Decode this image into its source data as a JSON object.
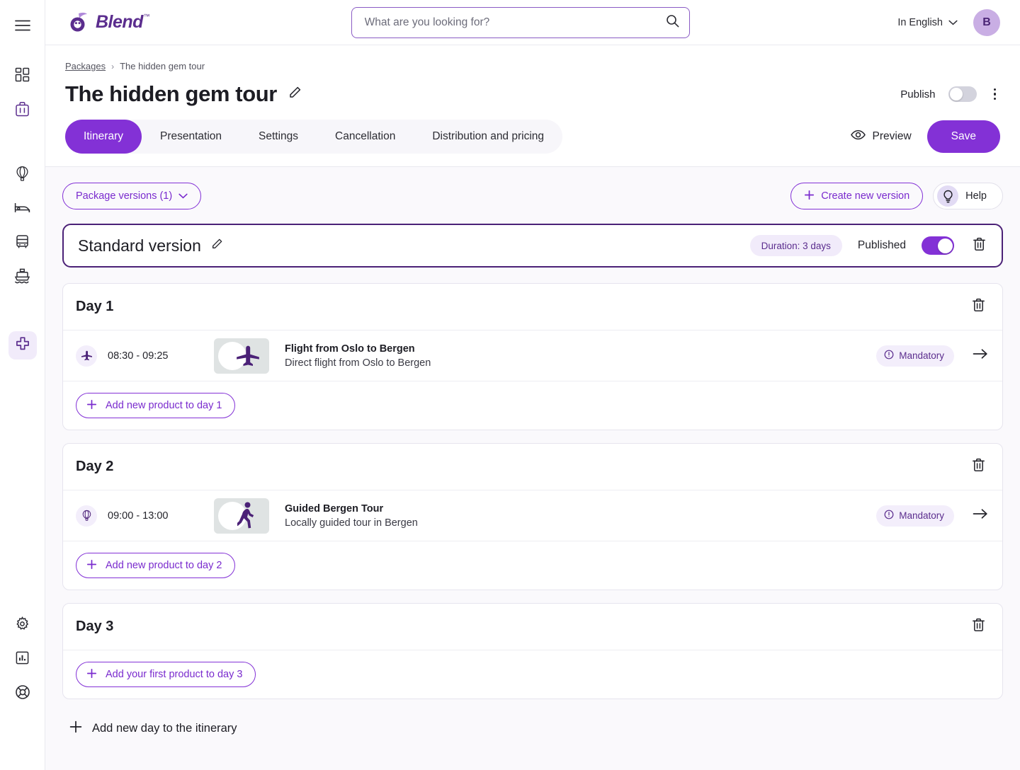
{
  "sidebar": {
    "menu_icon": "hamburger-icon",
    "items": [
      {
        "icon": "dashboard-grid-icon",
        "name": "dashboard",
        "active": false
      },
      {
        "icon": "suitcase-icon",
        "name": "trips",
        "active": false
      },
      {
        "icon": "balloon-icon",
        "name": "activities",
        "active": false
      },
      {
        "icon": "bed-icon",
        "name": "accommodation",
        "active": false
      },
      {
        "icon": "bus-icon",
        "name": "transport",
        "active": false
      },
      {
        "icon": "ship-icon",
        "name": "cruises",
        "active": false
      },
      {
        "icon": "packages-icon",
        "name": "packages",
        "active": true
      }
    ],
    "bottom_items": [
      {
        "icon": "gear-icon",
        "name": "settings"
      },
      {
        "icon": "chart-icon",
        "name": "reports"
      },
      {
        "icon": "lifebuoy-icon",
        "name": "support"
      }
    ]
  },
  "topbar": {
    "brand": "Blend",
    "brand_tm": "™",
    "search_placeholder": "What are you looking for?",
    "search_value": "",
    "language": "In English",
    "avatar_initial": "B"
  },
  "breadcrumb": {
    "root": "Packages",
    "separator": "›",
    "current": "The hidden gem tour"
  },
  "page": {
    "title": "The hidden gem tour",
    "publish_label": "Publish",
    "publish_on": false,
    "preview_label": "Preview",
    "save_label": "Save"
  },
  "tabs": [
    {
      "label": "Itinerary",
      "active": true
    },
    {
      "label": "Presentation",
      "active": false
    },
    {
      "label": "Settings",
      "active": false
    },
    {
      "label": "Cancellation",
      "active": false
    },
    {
      "label": "Distribution and pricing",
      "active": false
    }
  ],
  "toolbar": {
    "package_versions": "Package versions (1)",
    "create_new_version": "Create new version",
    "help": "Help"
  },
  "version": {
    "name": "Standard version",
    "duration_badge": "Duration: 3 days",
    "published_label": "Published",
    "published_on": true
  },
  "days": [
    {
      "title": "Day 1",
      "add_label": "Add new product to day 1",
      "products": [
        {
          "type_icon": "plane-icon",
          "time": "08:30 - 09:25",
          "thumb_glyph": "plane-icon",
          "name": "Flight from Oslo to Bergen",
          "description": "Direct flight from Oslo to Bergen",
          "badge": "Mandatory"
        }
      ]
    },
    {
      "title": "Day 2",
      "add_label": "Add new product to day 2",
      "products": [
        {
          "type_icon": "balloon-icon",
          "time": "09:00 - 13:00",
          "thumb_glyph": "walking-icon",
          "name": "Guided Bergen Tour",
          "description": "Locally guided tour in Bergen",
          "badge": "Mandatory"
        }
      ]
    },
    {
      "title": "Day 3",
      "add_label": "Add your first product to day 3",
      "products": []
    }
  ],
  "add_day_label": "Add new day to the itinerary",
  "colors": {
    "brand_purple": "#8331d6",
    "deep_purple": "#4b2177",
    "badge_bg": "#f1ebfa",
    "content_bg": "#faf9fc"
  }
}
